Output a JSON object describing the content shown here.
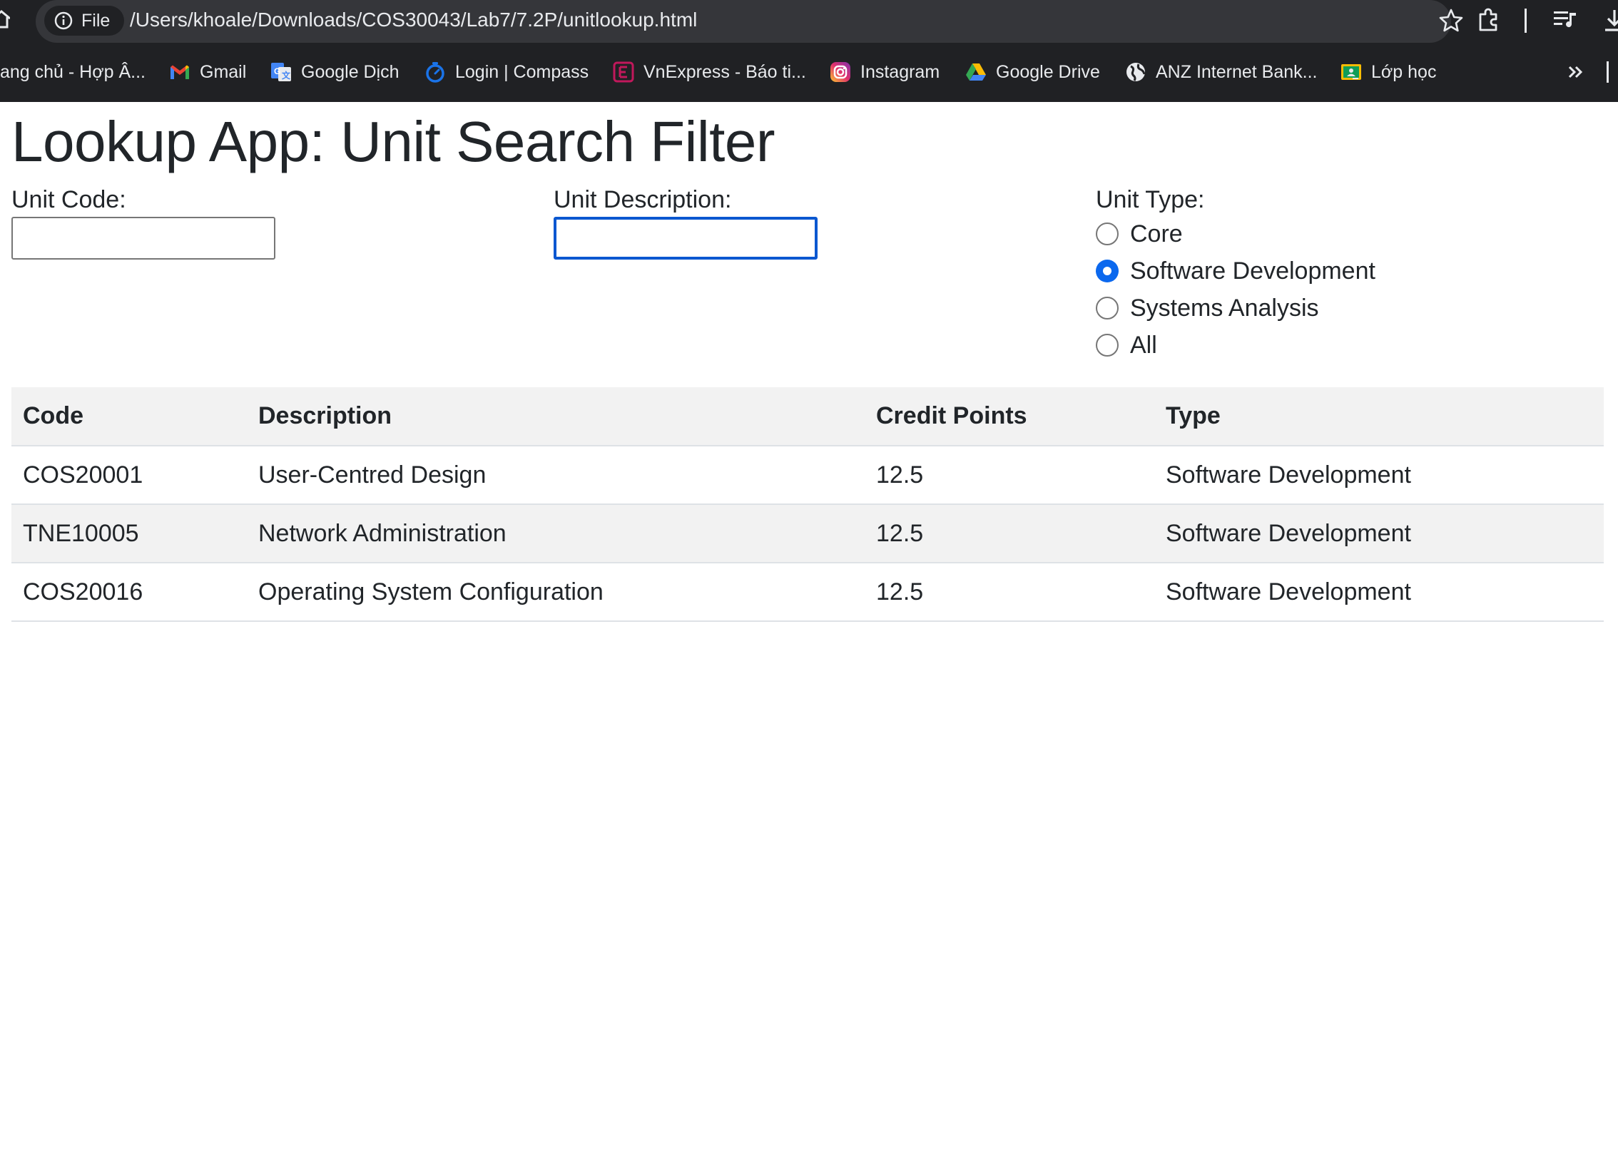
{
  "browser": {
    "chip_label": "File",
    "url": "/Users/khoale/Downloads/COS30043/Lab7/7.2P/unitlookup.html",
    "bookmarks": [
      {
        "label": "ang chủ - Hợp Â...",
        "icon": "none"
      },
      {
        "label": "Gmail",
        "icon": "gmail-icon"
      },
      {
        "label": "Google Dịch",
        "icon": "google-translate-icon"
      },
      {
        "label": "Login | Compass",
        "icon": "compass-icon"
      },
      {
        "label": "VnExpress - Báo ti...",
        "icon": "vnexpress-icon"
      },
      {
        "label": "Instagram",
        "icon": "instagram-icon"
      },
      {
        "label": "Google Drive",
        "icon": "google-drive-icon"
      },
      {
        "label": "ANZ Internet Bank...",
        "icon": "globe-icon"
      },
      {
        "label": "Lớp học",
        "icon": "google-classroom-icon"
      }
    ]
  },
  "page": {
    "title": "Lookup App: Unit Search Filter",
    "unit_code": {
      "label": "Unit Code:",
      "value": ""
    },
    "unit_description": {
      "label": "Unit Description:",
      "value": ""
    },
    "unit_type": {
      "label": "Unit Type:",
      "options": [
        {
          "label": "Core",
          "checked": false
        },
        {
          "label": "Software Development",
          "checked": true
        },
        {
          "label": "Systems Analysis",
          "checked": false
        },
        {
          "label": "All",
          "checked": false
        }
      ]
    },
    "table": {
      "headers": [
        "Code",
        "Description",
        "Credit Points",
        "Type"
      ],
      "rows": [
        [
          "COS20001",
          "User-Centred Design",
          "12.5",
          "Software Development"
        ],
        [
          "TNE10005",
          "Network Administration",
          "12.5",
          "Software Development"
        ],
        [
          "COS20016",
          "Operating System Configuration",
          "12.5",
          "Software Development"
        ]
      ]
    }
  },
  "colors": {
    "chrome_bg": "#202124",
    "omnibox_bg": "#35363a",
    "accent_blue": "#0b68ee",
    "stripe": "#f2f2f2"
  }
}
